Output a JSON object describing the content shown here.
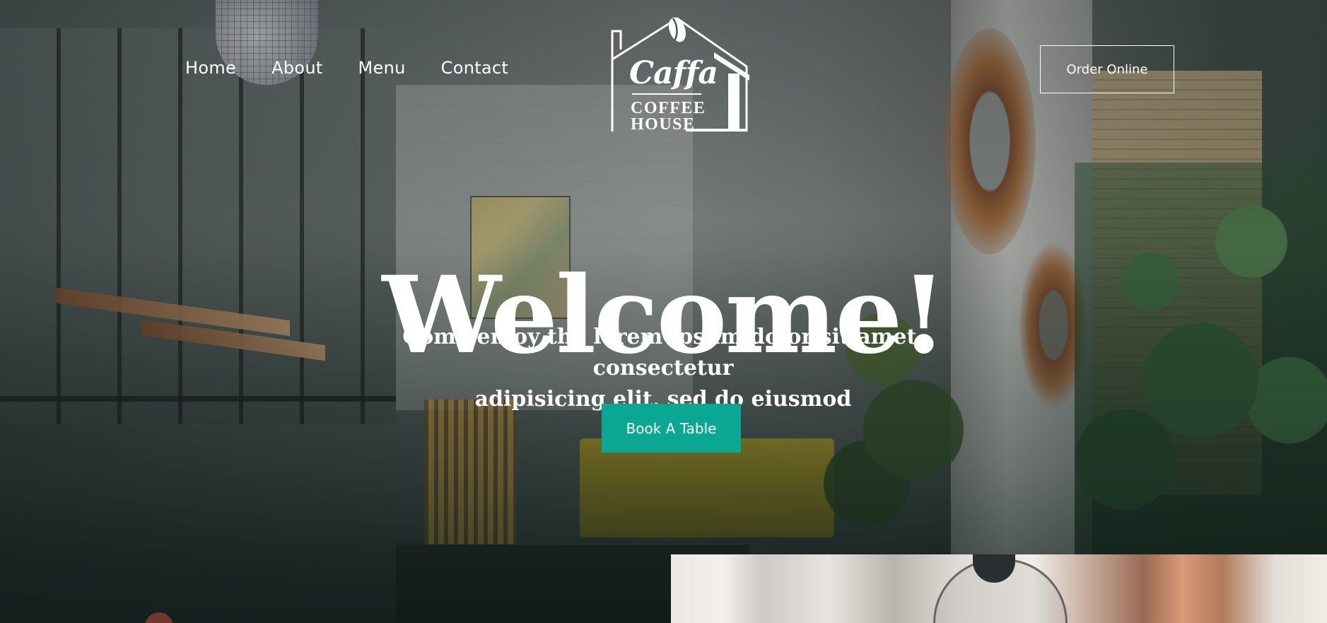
{
  "nav": {
    "items": [
      {
        "label": "Home"
      },
      {
        "label": "About"
      },
      {
        "label": "Menu"
      },
      {
        "label": "Contact"
      }
    ]
  },
  "logo": {
    "script": "Caffa",
    "line1": "COFFEE",
    "line2": "HOUSE",
    "icon": "house-with-coffee-bean-icon"
  },
  "header": {
    "order_label": "Order Online"
  },
  "hero": {
    "title": "Welcome!",
    "subtitle_line1": "Come enjoy the lorem ipsum dolor sit amet, consectetur",
    "subtitle_line2": "adipisicing elit, sed do eiusmod",
    "cta_label": "Book A Table",
    "background": "cafe-interior-photo"
  },
  "colors": {
    "accent": "#0aa892",
    "text": "#ffffff"
  },
  "next_section": {
    "image": "french-press-photo"
  }
}
